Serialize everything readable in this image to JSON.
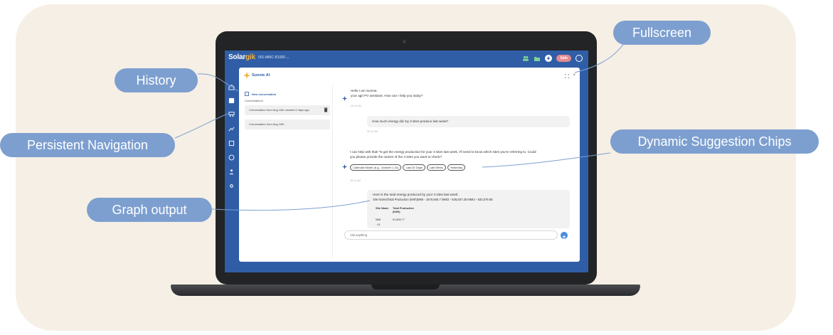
{
  "app": {
    "logo_main": "Solar",
    "logo_accent": "gik",
    "site_selector": "001-MMC-B1000  ⌄",
    "header_badge": "Safe"
  },
  "assistant": {
    "title": "Sunnie AI"
  },
  "history": {
    "new_conversation": "New conversation",
    "conversations_label": "Conversations",
    "items": [
      "Conversation from Aug 10th created 4 days ago",
      "Conversation from Aug 10th"
    ]
  },
  "chat": {
    "greeting_line1": "Hello I am Sunnie,",
    "greeting_line2": "your agri PV assistant. How can I help you today?",
    "ts1": "00:11 AM",
    "user_question": "How much energy did my 3 sites produce last week?",
    "ts2": "00:11 AM",
    "assistant_reply_line1": "I can help with that! To get the energy production for your 3 sites last week, I'll need to know which sites you're referring to. Could",
    "assistant_reply_line2": "you please provide the names of the 3 sites you want to check?",
    "chips": [
      "Calendar Month (e.g., October 1-31)",
      "Last 30 Days",
      "Last Week",
      "Yesterday"
    ],
    "ts3": "00:11 AM",
    "result_line1": "Here is the total energy produced by your 3 sites last week:",
    "result_line2": "Site Name|Total Production (kWh)MMI - 1670,605.7 MMI2 - 628,837.28 MMI3 - 832,679.58",
    "table_headers": [
      "Site Name",
      "Total Production (kWh)"
    ],
    "table_row": [
      "MMI - 01",
      "51,665.77"
    ],
    "ask_placeholder": "Ask anything"
  },
  "callouts": {
    "fullscreen": "Fullscreen",
    "history": "History",
    "persistent_navigation": "Persistent Navigation",
    "dynamic_suggestion_chips": "Dynamic Suggestion Chips",
    "graph_output": "Graph output"
  },
  "colors": {
    "brand_blue": "#2f5ea7",
    "callout_blue": "#7d9fd0",
    "accent_orange": "#f3b13a",
    "badge_pink": "#e28a8e",
    "background_beige": "#f6efe5"
  }
}
